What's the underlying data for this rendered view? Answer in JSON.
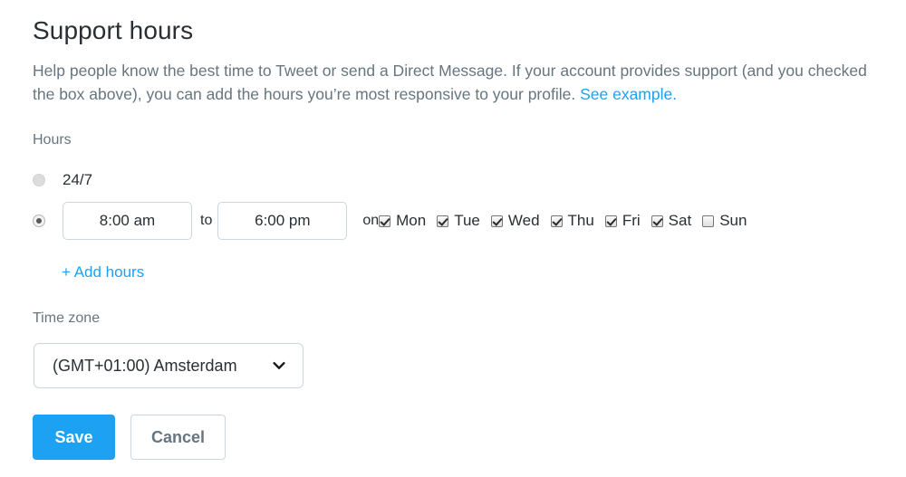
{
  "section": {
    "title": "Support hours",
    "description_part1": "Help people know the best time to Tweet or send a Direct Message. If your account provides support (and you checked the box above), you can add the hours you’re most responsive to your profile. ",
    "description_link": "See example."
  },
  "hours": {
    "label": "Hours",
    "option_247": {
      "label": "24/7",
      "selected": false
    },
    "option_custom": {
      "selected": true,
      "start_time": "8:00 am",
      "start_placeholder": "8:00 am",
      "to_label": "to",
      "end_time": "6:00 pm",
      "end_placeholder": "6:00 pm",
      "on_label": "on",
      "days": [
        {
          "label": "Mon",
          "checked": true
        },
        {
          "label": "Tue",
          "checked": true
        },
        {
          "label": "Wed",
          "checked": true
        },
        {
          "label": "Thu",
          "checked": true
        },
        {
          "label": "Fri",
          "checked": true
        },
        {
          "label": "Sat",
          "checked": true
        },
        {
          "label": "Sun",
          "checked": false
        }
      ]
    },
    "add_hours_label": "+ Add hours"
  },
  "timezone": {
    "label": "Time zone",
    "selected": "(GMT+01:00) Amsterdam",
    "chevron_icon": "chevron-down-icon"
  },
  "actions": {
    "save_label": "Save",
    "cancel_label": "Cancel"
  },
  "colors": {
    "accent_blue": "#1da1f2",
    "text_dark": "#292f33",
    "text_muted": "#66757f",
    "border_light": "#ccd6dd"
  }
}
